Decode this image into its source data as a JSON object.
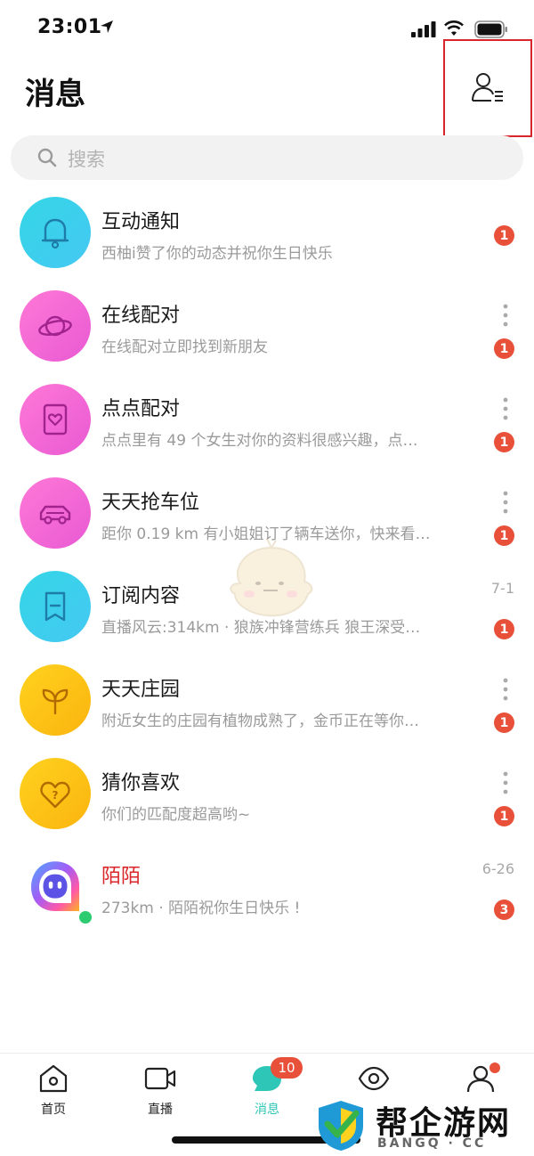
{
  "status_bar": {
    "time": "23:01"
  },
  "header": {
    "title": "消息"
  },
  "search": {
    "placeholder": "搜索"
  },
  "messages": [
    {
      "title": "互动通知",
      "preview": "西柚i赞了你的动态并祝你生日快乐",
      "time": "",
      "badge": "1",
      "icon": "bell-icon",
      "color": "#3dd4e8"
    },
    {
      "title": "在线配对",
      "preview": "在线配对立即找到新朋友",
      "time": "",
      "badge": "1",
      "icon": "planet-icon",
      "color": "#f26ad6"
    },
    {
      "title": "点点配对",
      "preview": "点点里有 49 个女生对你的资料很感兴趣，点…",
      "time": "",
      "badge": "1",
      "icon": "heart-card-icon",
      "color": "#f26ad6"
    },
    {
      "title": "天天抢车位",
      "preview": "距你 0.19 km 有小姐姐订了辆车送你，快来看…",
      "time": "",
      "badge": "1",
      "icon": "car-icon",
      "color": "#f26ad6"
    },
    {
      "title": "订阅内容",
      "preview": "直播风云:314km · 狼族冲锋营练兵 狼王深受…",
      "time": "7-1",
      "badge": "1",
      "icon": "bookmark-icon",
      "color": "#3dd4e8"
    },
    {
      "title": "天天庄园",
      "preview": "附近女生的庄园有植物成熟了，金币正在等你…",
      "time": "",
      "badge": "1",
      "icon": "sprout-icon",
      "color": "#fdc316"
    },
    {
      "title": "猜你喜欢",
      "preview": "你们的匹配度超高哟~",
      "time": "",
      "badge": "1",
      "icon": "heart-question-icon",
      "color": "#fdc316"
    },
    {
      "title": "陌陌",
      "preview": "273km · 陌陌祝你生日快乐 !",
      "time": "6-26",
      "badge": "3",
      "icon": "momo-logo-icon",
      "color": "#e8503a"
    }
  ],
  "tabs": [
    {
      "label": "首页",
      "icon": "home-icon"
    },
    {
      "label": "直播",
      "icon": "video-icon"
    },
    {
      "label": "消息",
      "icon": "chat-bubble-icon",
      "badge": "10"
    },
    {
      "label": "",
      "icon": "eye-icon"
    },
    {
      "label": "",
      "icon": "profile-icon"
    }
  ],
  "brand": {
    "name": "帮企游网",
    "sub": "BANGQ · CC"
  }
}
